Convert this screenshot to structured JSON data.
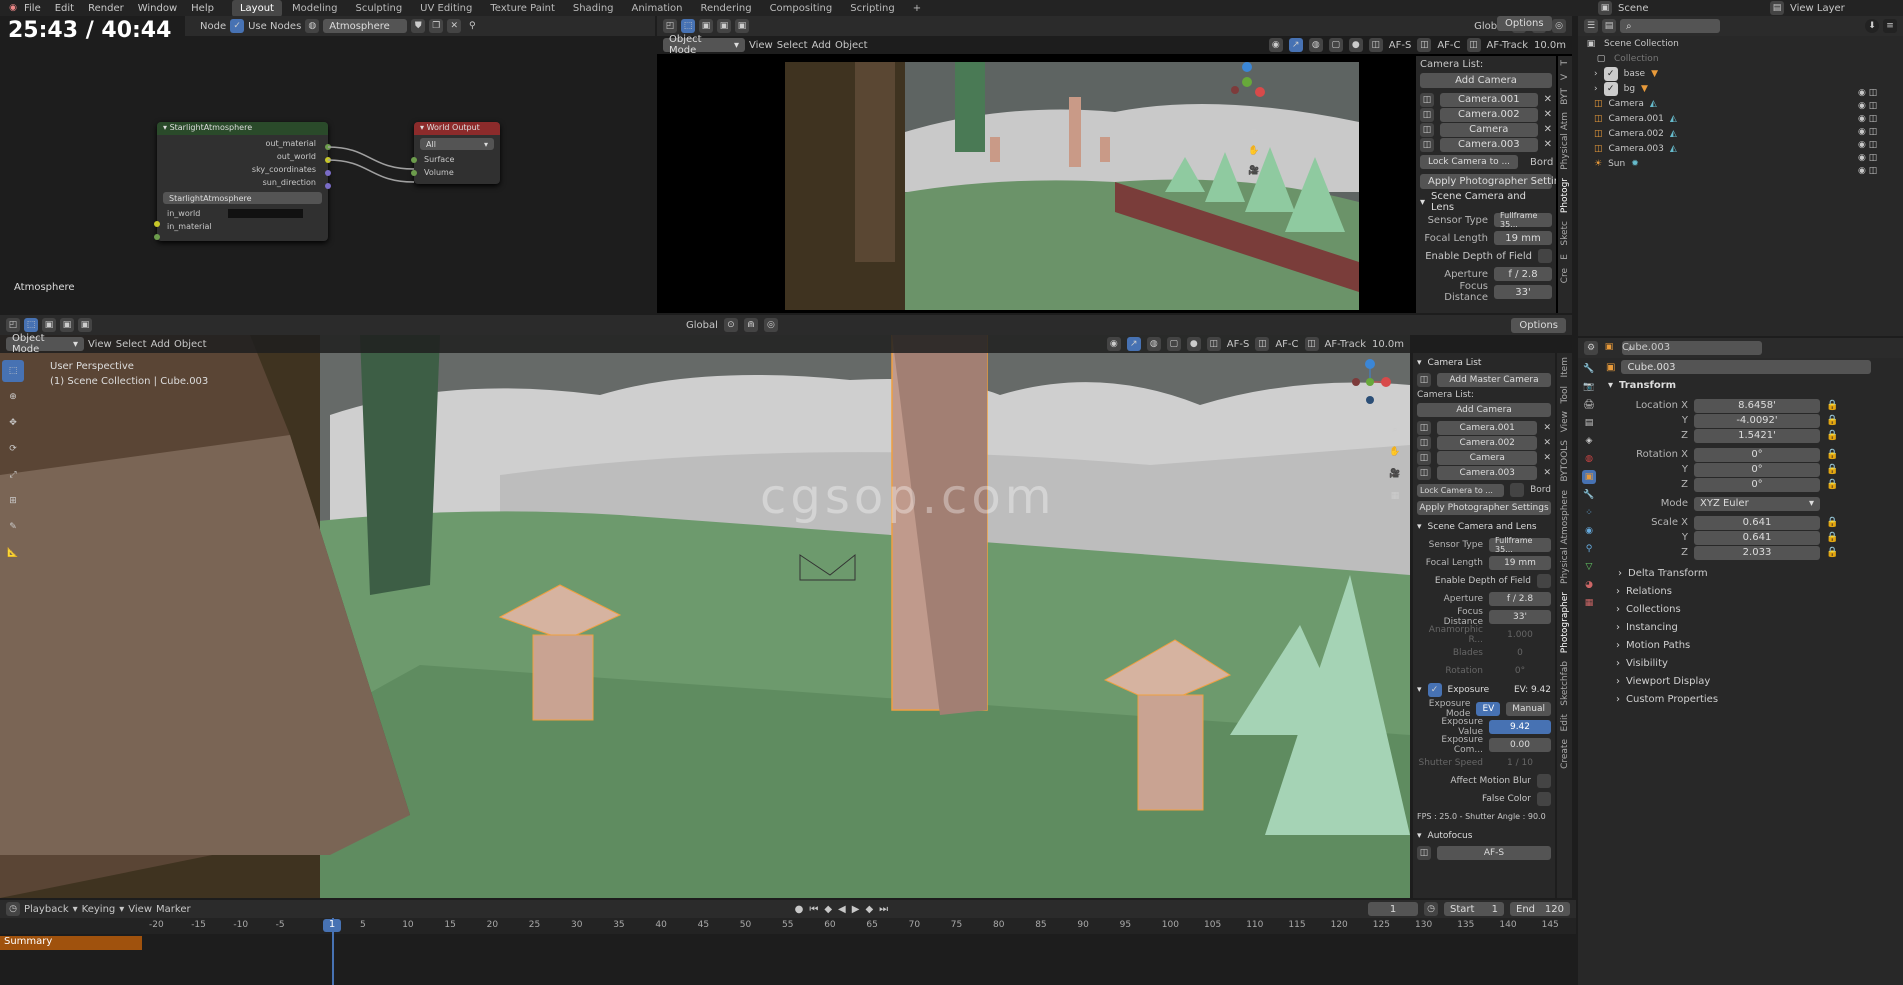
{
  "timer": "25:43 / 40:44",
  "watermark": "cgsop.com",
  "topbar": {
    "menus": [
      "File",
      "Edit",
      "Render",
      "Window",
      "Help"
    ],
    "workspaces": [
      "Layout",
      "Modeling",
      "Sculpting",
      "UV Editing",
      "Texture Paint",
      "Shading",
      "Animation",
      "Rendering",
      "Compositing",
      "Scripting"
    ],
    "scene": "Scene",
    "view_layer": "View Layer"
  },
  "node_editor": {
    "node_label": "Node",
    "use_nodes": "Use Nodes",
    "world_name": "Atmosphere",
    "bottom_label": "Atmosphere",
    "node1": {
      "title": "StarlightAtmosphere",
      "outputs": [
        "out_material",
        "out_world",
        "sky_coordinates",
        "sun_direction"
      ],
      "group": "StarlightAtmosphere",
      "inputs": [
        "in_world",
        "in_material"
      ]
    },
    "node2": {
      "title": "World Output",
      "target": "All",
      "inputs": [
        "Surface",
        "Volume"
      ]
    }
  },
  "top_view": {
    "mode": "Object Mode",
    "menus": [
      "View",
      "Select",
      "Add",
      "Object"
    ],
    "orient": "Global",
    "options": "Options",
    "afs": "AF-S",
    "afc": "AF-C",
    "aftrack": "AF-Track",
    "dist": "10.0m"
  },
  "top_panel": {
    "camera_list": "Camera List:",
    "add_camera": "Add Camera",
    "cameras": [
      "Camera.001",
      "Camera.002",
      "Camera",
      "Camera.003"
    ],
    "lock": "Lock Camera to ...",
    "bord": "Bord",
    "apply": "Apply Photographer Settings",
    "scene_cam": "Scene Camera and Lens",
    "sensor_label": "Sensor Type",
    "sensor": "Fullframe 35...",
    "focal_label": "Focal Length",
    "focal": "19 mm",
    "dof": "Enable Depth of Field",
    "aperture_label": "Aperture",
    "aperture": "f / 2.8",
    "focus_label": "Focus Distance",
    "focus": "33'",
    "tabs": [
      "Photogr",
      "Sketc",
      "E",
      "Cre",
      "Physical Atm",
      "BYT",
      "V",
      "T"
    ]
  },
  "main_view": {
    "mode": "Object Mode",
    "menus": [
      "View",
      "Select",
      "Add",
      "Object"
    ],
    "orient": "Global",
    "options": "Options",
    "persp": "User Perspective",
    "collection": "(1) Scene Collection | Cube.003",
    "afs": "AF-S",
    "afc": "AF-C",
    "aftrack": "AF-Track",
    "dist": "10.0m"
  },
  "main_panel": {
    "camera_list_head": "Camera List",
    "add_master": "Add Master Camera",
    "camera_list": "Camera List:",
    "add_camera": "Add Camera",
    "cameras": [
      "Camera.001",
      "Camera.002",
      "Camera",
      "Camera.003"
    ],
    "lock": "Lock Camera to ...",
    "bord": "Bord",
    "apply": "Apply Photographer Settings",
    "scene_cam": "Scene Camera and Lens",
    "sensor_label": "Sensor Type",
    "sensor": "Fullframe 35...",
    "focal_label": "Focal Length",
    "focal": "19 mm",
    "dof": "Enable Depth of Field",
    "aperture_label": "Aperture",
    "aperture": "f / 2.8",
    "focus_label": "Focus Distance",
    "focus": "33'",
    "anam_label": "Anamorphic R...",
    "anam": "1.000",
    "blades_label": "Blades",
    "blades": "0",
    "rotation_label": "Rotation",
    "rotation": "0°",
    "exposure": "Exposure",
    "ev_readout": "EV: 9.42",
    "exp_mode_label": "Exposure Mode",
    "ev_btn": "EV",
    "manual_btn": "Manual",
    "exp_value_label": "Exposure Value",
    "exp_value": "9.42",
    "exp_comp_label": "Exposure Com...",
    "exp_comp": "0.00",
    "shutter_label": "Shutter Speed",
    "shutter": "1 / 10",
    "motion_blur": "Affect Motion Blur",
    "false_color": "False Color",
    "fps": "FPS : 25.0 - Shutter Angle : 90.0",
    "autofocus": "Autofocus",
    "afs": "AF-S",
    "tabs": [
      "Item",
      "Tool",
      "View",
      "BYTOOLS",
      "Physical Atmosphere",
      "Photographer",
      "Sketchfab",
      "Edit",
      "Create"
    ]
  },
  "outliner": {
    "root": "Scene Collection",
    "items": [
      "Collection",
      "base",
      "bg",
      "Camera",
      "Camera.001",
      "Camera.002",
      "Camera.003",
      "Sun"
    ]
  },
  "properties": {
    "object": "Cube.003",
    "object2": "Cube.003",
    "transform": "Transform",
    "loc_label": "Location X",
    "rot_label": "Rotation X",
    "mode_label": "Mode",
    "scale_label": "Scale X",
    "y": "Y",
    "z": "Z",
    "loc": [
      "8.6458'",
      "-4.0092'",
      "1.5421'"
    ],
    "rot": [
      "0°",
      "0°",
      "0°"
    ],
    "mode": "XYZ Euler",
    "scale": [
      "0.641",
      "0.641",
      "2.033"
    ],
    "sections": [
      "Delta Transform",
      "Relations",
      "Collections",
      "Instancing",
      "Motion Paths",
      "Visibility",
      "Viewport Display",
      "Custom Properties"
    ]
  },
  "timeline": {
    "menus": [
      "Playback",
      "Keying",
      "View",
      "Marker"
    ],
    "frame": "1",
    "start_label": "Start",
    "start": "1",
    "end_label": "End",
    "end": "120",
    "summary": "Summary",
    "current": "1",
    "ticks": [
      "-20",
      "-15",
      "-10",
      "-5",
      "1",
      "5",
      "10",
      "15",
      "20",
      "25",
      "30",
      "35",
      "40",
      "45",
      "50",
      "55",
      "60",
      "65",
      "70",
      "75",
      "80",
      "85",
      "90",
      "95",
      "100",
      "105",
      "110",
      "115",
      "120",
      "125",
      "130",
      "135",
      "140",
      "145"
    ]
  }
}
